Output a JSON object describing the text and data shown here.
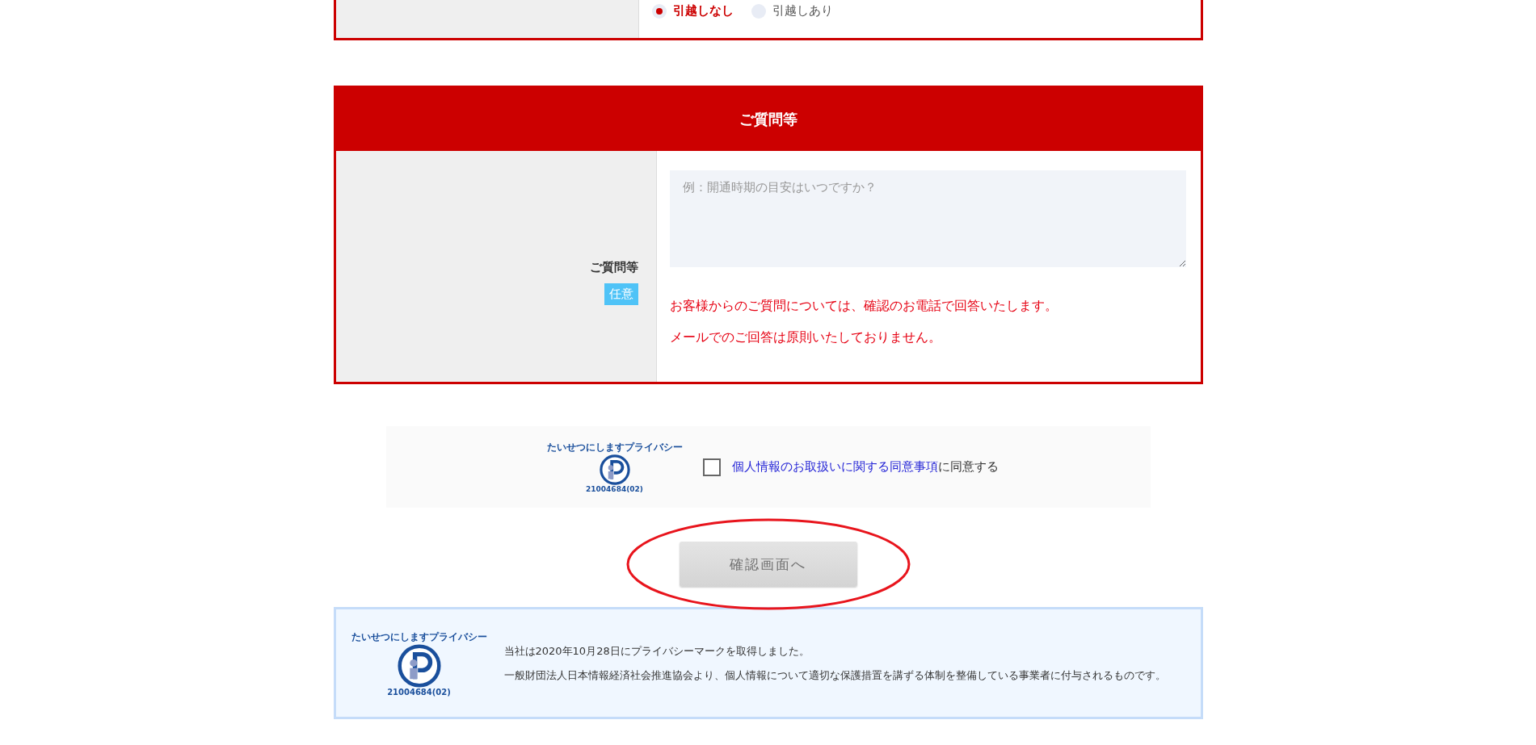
{
  "moving_section": {
    "options": [
      {
        "label": "引越しなし",
        "selected": true
      },
      {
        "label": "引越しあり",
        "selected": false
      }
    ]
  },
  "question_section": {
    "title": "ご質問等",
    "label": "ご質問等",
    "badge": "任意",
    "placeholder": "例：開通時期の目安はいつですか？",
    "notes": [
      "お客様からのご質問については、確認のお電話で回答いたします。",
      "メールでのご回答は原則いたしておりません。"
    ]
  },
  "consent": {
    "logo": {
      "tagline": "たいせつにしますプライバシー",
      "number": "21004684(02)"
    },
    "checked": false,
    "link": "個人情報のお取扱いに関する同意事項",
    "text": "に同意する"
  },
  "confirm_button": {
    "label": "確認画面へ",
    "disabled": true
  },
  "privacy_notice": {
    "logo": {
      "tagline": "たいせつにしますプライバシー",
      "number": "21004684(02)"
    },
    "lines": [
      "当社は2020年10月28日にプライバシーマークを取得しました。",
      "一般財団法人日本情報経済社会推進協会より、個人情報について適切な保護措置を講ずる体制を整備している事業者に付与されるものです。"
    ]
  }
}
